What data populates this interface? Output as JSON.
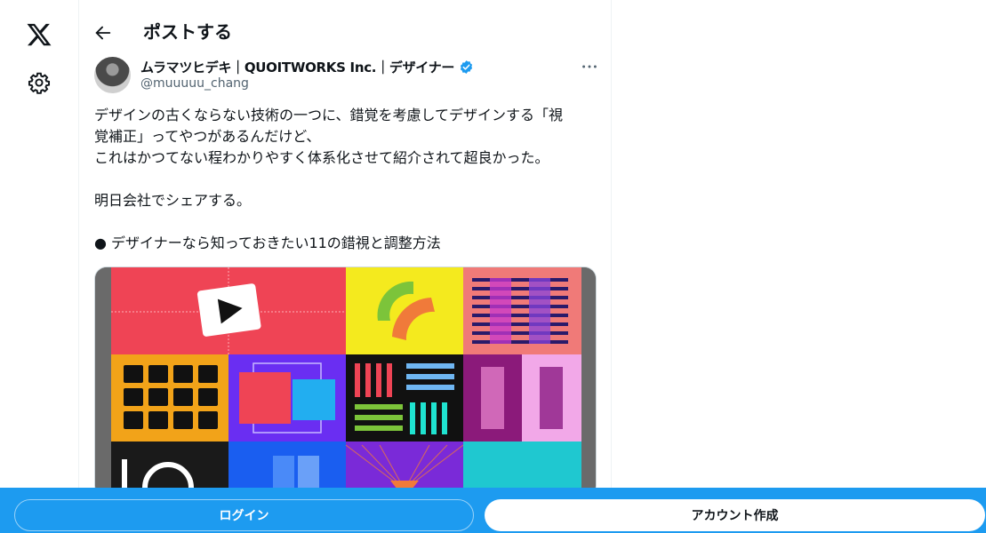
{
  "nav": {
    "logo_icon": "x-logo-icon",
    "settings_icon": "gear-icon"
  },
  "header": {
    "title": "ポストする",
    "back_icon": "arrow-left-icon"
  },
  "post": {
    "author_name": "ムラマツヒデキ｜QUOITWORKS Inc.｜デザイナー",
    "handle": "@muuuuu_chang",
    "verified": true,
    "more_icon": "more-icon",
    "lines": [
      "デザインの古くならない技術の一つに、錯覚を考慮してデザインする「視",
      "覚補正」ってやつがあるんだけど、",
      "これはかつてない程わかりやすく体系化させて紹介されて超良かった。",
      "",
      "明日会社でシェアする。",
      "",
      "● デザイナーなら知っておきたい11の錯視と調整方法"
    ]
  },
  "bottom_bar": {
    "login_label": "ログイン",
    "signup_label": "アカウント作成"
  },
  "colors": {
    "accent": "#1d9bf0",
    "text": "#0f1419",
    "secondary": "#536471"
  }
}
